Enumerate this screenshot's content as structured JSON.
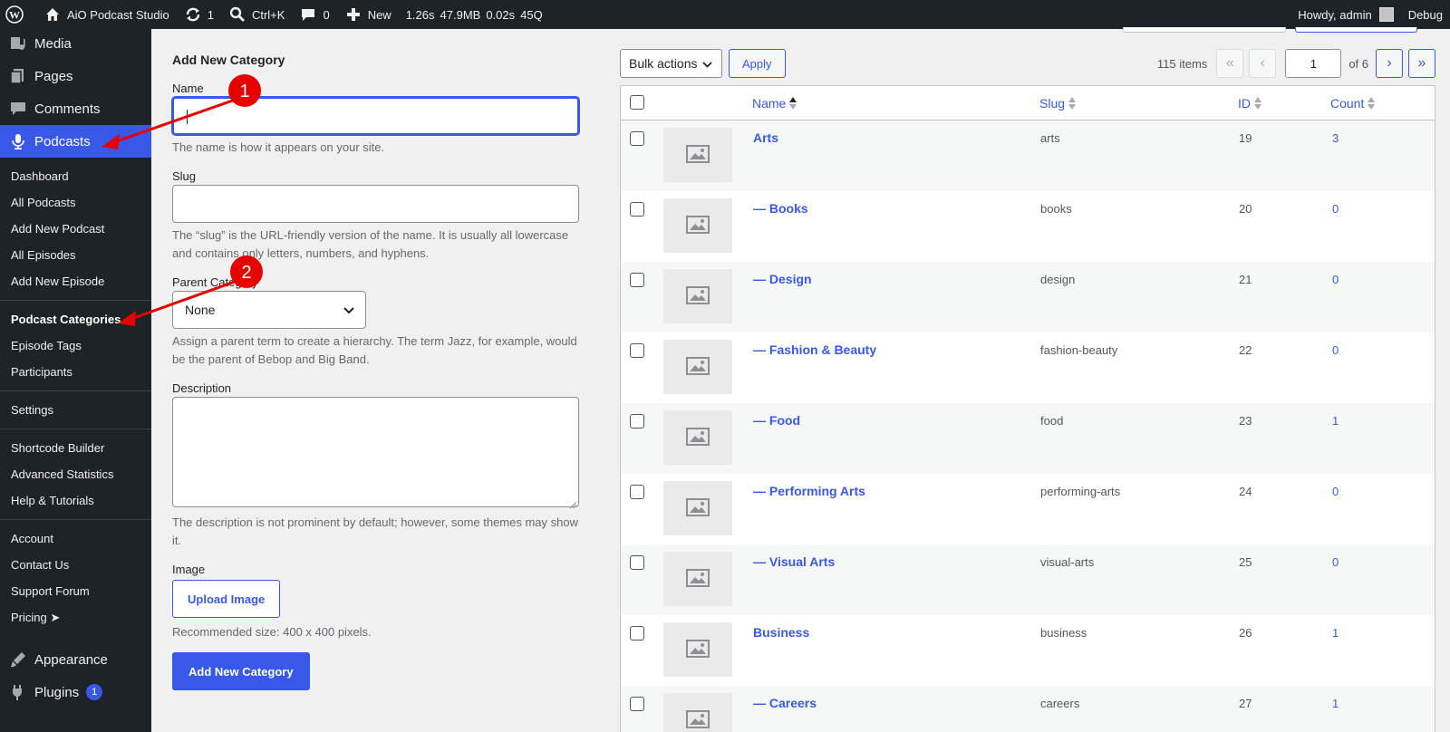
{
  "adminbar": {
    "site_name": "AiO Podcast Studio",
    "updates_count": "1",
    "shortcut": "Ctrl+K",
    "comments_count": "0",
    "new_label": "New",
    "perf": [
      "1.26s",
      "47.9MB",
      "0.02s",
      "45Q"
    ],
    "howdy": "Howdy, admin",
    "debug": "Debug"
  },
  "sidebar": {
    "top_items": [
      {
        "label": "Media",
        "icon": "media-icon"
      },
      {
        "label": "Pages",
        "icon": "pages-icon"
      },
      {
        "label": "Comments",
        "icon": "comments-icon"
      },
      {
        "label": "Podcasts",
        "icon": "microphone-icon"
      }
    ],
    "podcast_sub": [
      "Dashboard",
      "All Podcasts",
      "Add New Podcast",
      "All Episodes",
      "Add New Episode"
    ],
    "taxonomy_sub": [
      "Podcast Categories",
      "Episode Tags",
      "Participants"
    ],
    "settings_sub": [
      "Settings"
    ],
    "tools_sub": [
      "Shortcode Builder",
      "Advanced Statistics",
      "Help & Tutorials"
    ],
    "account_sub": [
      "Account",
      "Contact Us",
      "Support Forum",
      "Pricing ➤"
    ],
    "bottom_items": [
      {
        "label": "Appearance",
        "icon": "appearance-icon"
      },
      {
        "label": "Plugins",
        "icon": "plugins-icon",
        "badge": "1"
      }
    ]
  },
  "form": {
    "title": "Add New Category",
    "name_label": "Name",
    "name_help": "The name is how it appears on your site.",
    "slug_label": "Slug",
    "slug_help": "The “slug” is the URL-friendly version of the name. It is usually all lowercase and contains only letters, numbers, and hyphens.",
    "parent_label": "Parent Category",
    "parent_value": "None",
    "parent_help": "Assign a parent term to create a hierarchy. The term Jazz, for example, would be the parent of Bebop and Big Band.",
    "desc_label": "Description",
    "desc_help": "The description is not prominent by default; however, some themes may show it.",
    "image_label": "Image",
    "upload_label": "Upload Image",
    "image_help": "Recommended size: 400 x 400 pixels.",
    "submit_label": "Add New Category"
  },
  "tablenav": {
    "bulk_label": "Bulk actions",
    "apply_label": "Apply",
    "items": "115 items",
    "first": "«",
    "prev": "‹",
    "page": "1",
    "of_pages": "of 6",
    "next": "›",
    "last": "»"
  },
  "table": {
    "columns": {
      "name": "Name",
      "slug": "Slug",
      "id": "ID",
      "count": "Count"
    },
    "rows": [
      {
        "name": "Arts",
        "slug": "arts",
        "id": "19",
        "count": "3"
      },
      {
        "name": "— Books",
        "slug": "books",
        "id": "20",
        "count": "0"
      },
      {
        "name": "— Design",
        "slug": "design",
        "id": "21",
        "count": "0"
      },
      {
        "name": "— Fashion & Beauty",
        "slug": "fashion-beauty",
        "id": "22",
        "count": "0"
      },
      {
        "name": "— Food",
        "slug": "food",
        "id": "23",
        "count": "1"
      },
      {
        "name": "— Performing Arts",
        "slug": "performing-arts",
        "id": "24",
        "count": "0"
      },
      {
        "name": "— Visual Arts",
        "slug": "visual-arts",
        "id": "25",
        "count": "0"
      },
      {
        "name": "Business",
        "slug": "business",
        "id": "26",
        "count": "1"
      },
      {
        "name": "— Careers",
        "slug": "careers",
        "id": "27",
        "count": "1"
      }
    ]
  },
  "annotations": {
    "marker_1": "1",
    "marker_2": "2"
  },
  "colors": {
    "accent": "#3858e9",
    "adminbar": "#1d2327",
    "annotation": "#e60000"
  }
}
